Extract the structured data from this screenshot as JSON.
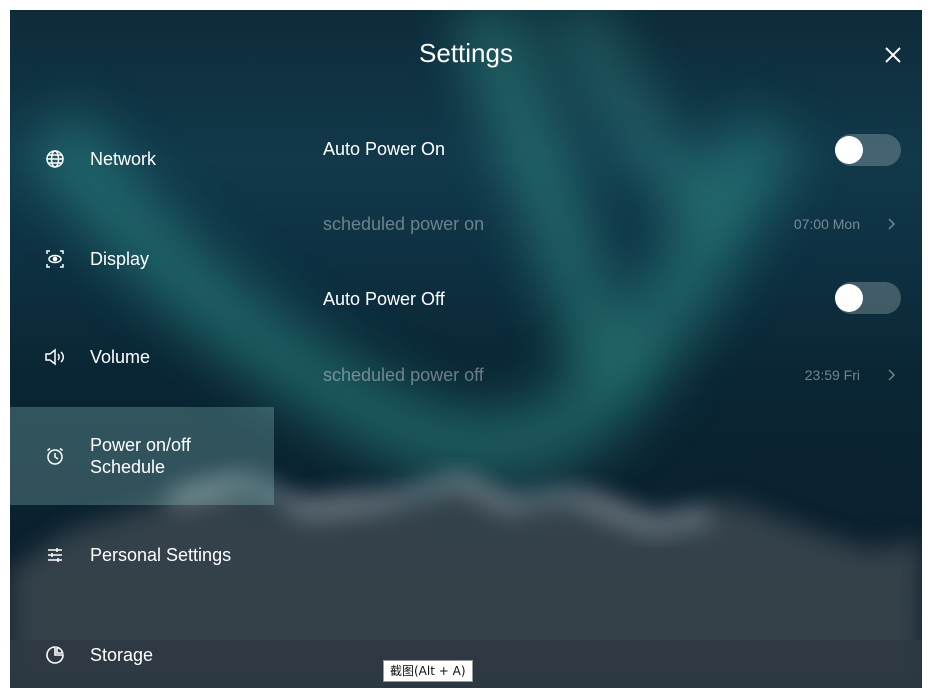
{
  "header": {
    "title": "Settings",
    "close_icon": "close-icon"
  },
  "sidebar": {
    "items": [
      {
        "label": "Network",
        "icon": "globe-icon",
        "active": false
      },
      {
        "label": "Display",
        "icon": "display-icon",
        "active": false
      },
      {
        "label": "Volume",
        "icon": "speaker-icon",
        "active": false
      },
      {
        "label": "Power on/off\nSchedule",
        "icon": "alarm-clock-icon",
        "active": true
      },
      {
        "label": "Personal Settings",
        "icon": "sliders-icon",
        "active": false
      },
      {
        "label": "Storage",
        "icon": "pie-chart-icon",
        "active": false
      }
    ]
  },
  "main": {
    "auto_power_on": {
      "label": "Auto Power On",
      "enabled": false
    },
    "scheduled_power_on": {
      "label": "scheduled power on",
      "value": "07:00 Mon"
    },
    "auto_power_off": {
      "label": "Auto Power Off",
      "enabled": false
    },
    "scheduled_power_off": {
      "label": "scheduled power off",
      "value": "23:59 Fri"
    }
  },
  "tooltip": {
    "text": "截图(Alt + A)"
  },
  "colors": {
    "active_item_bg": "#6fb8b3",
    "text_primary": "#ffffff",
    "text_disabled": "#8a9aa2"
  }
}
